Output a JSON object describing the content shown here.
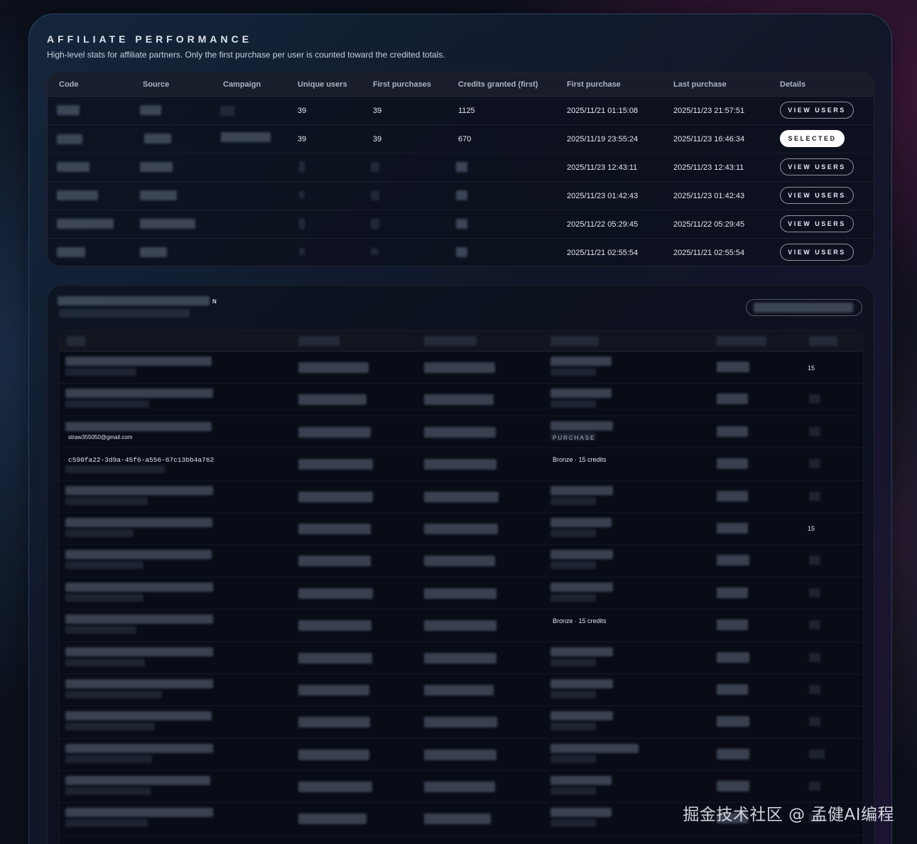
{
  "section": {
    "title": "AFFILIATE PERFORMANCE",
    "subtitle": "High-level stats for affiliate partners. Only the first purchase per user is counted toward the credited totals."
  },
  "performance": {
    "columns": [
      "Code",
      "Source",
      "Campaign",
      "Unique users",
      "First purchases",
      "Credits granted (first)",
      "First purchase",
      "Last purchase",
      "Details"
    ],
    "rows": [
      {
        "unique_users": "39",
        "first_purchases": "39",
        "credits": "1125",
        "first_purchase": "2025/11/21 01:15:08",
        "last_purchase": "2025/11/23 21:57:51",
        "action": "VIEW USERS",
        "selected": false
      },
      {
        "unique_users": "39",
        "first_purchases": "39",
        "credits": "670",
        "first_purchase": "2025/11/19 23:55:24",
        "last_purchase": "2025/11/23 16:46:34",
        "action": "SELECTED",
        "selected": true
      },
      {
        "unique_users": "",
        "first_purchases": "",
        "credits": "",
        "first_purchase": "2025/11/23 12:43:11",
        "last_purchase": "2025/11/23 12:43:11",
        "action": "VIEW USERS",
        "selected": false
      },
      {
        "unique_users": "",
        "first_purchases": "",
        "credits": "",
        "first_purchase": "2025/11/23 01:42:43",
        "last_purchase": "2025/11/23 01:42:43",
        "action": "VIEW USERS",
        "selected": false
      },
      {
        "unique_users": "",
        "first_purchases": "",
        "credits": "",
        "first_purchase": "2025/11/22 05:29:45",
        "last_purchase": "2025/11/22 05:29:45",
        "action": "VIEW USERS",
        "selected": false
      },
      {
        "unique_users": "",
        "first_purchases": "",
        "credits": "",
        "first_purchase": "2025/11/21 02:55:54",
        "last_purchase": "2025/11/21 02:55:54",
        "action": "VIEW USERS",
        "selected": false
      }
    ]
  },
  "users_panel": {
    "title_suffix": "N",
    "visible_cells": {
      "row0_credits": "15",
      "row2_email": "straw355050@gmail.com",
      "row2_tag": "PURCHASE",
      "row3_id": "c590fa22-3d9a-45f6-a556-67c13bb4a762",
      "row3_package": "Bronze · 15 credits",
      "row5_credits": "15",
      "row8_package": "Bronze · 15 credits"
    }
  },
  "watermark": "掘金技术社区 @ 孟健AI编程"
}
